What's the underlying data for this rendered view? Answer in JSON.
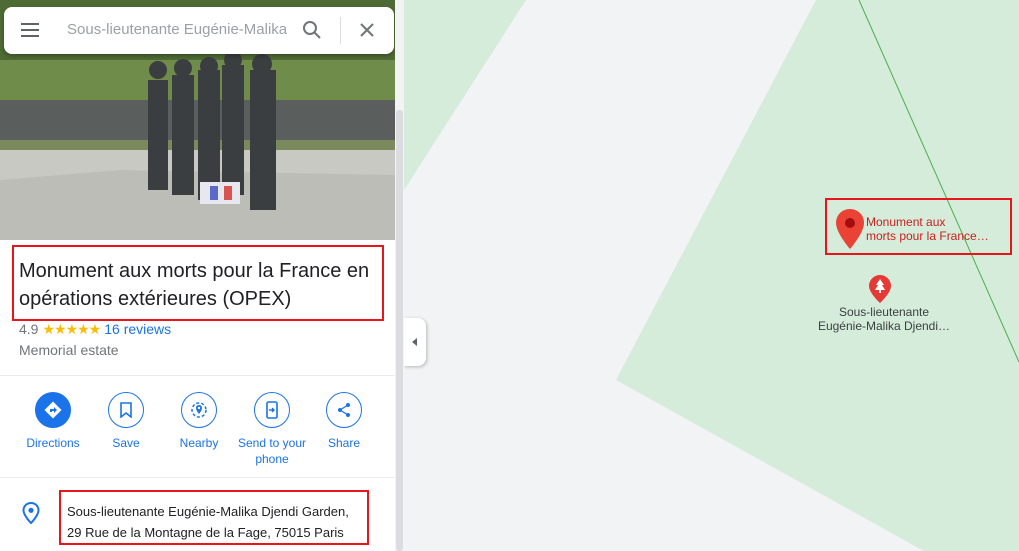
{
  "search": {
    "value": "Sous-lieutenante Eugénie-Malika Djendi Garden"
  },
  "place": {
    "title": "Monument aux morts pour la France en opérations extérieures (OPEX)",
    "rating": "4.9",
    "stars": "★★★★★",
    "reviews": "16 reviews",
    "category": "Memorial estate",
    "address_line1": "Sous-lieutenante Eugénie-Malika Djendi Garden,",
    "address_line2": "29 Rue de la Montagne de la Fage, 75015 Paris"
  },
  "actions": [
    {
      "label": "Directions",
      "icon": "directions-icon"
    },
    {
      "label": "Save",
      "icon": "bookmark-icon"
    },
    {
      "label": "Nearby",
      "icon": "nearby-icon"
    },
    {
      "label": "Send to your phone",
      "icon": "send-to-phone-icon"
    },
    {
      "label": "Share",
      "icon": "share-icon"
    }
  ],
  "map": {
    "pin_label_line1": "Monument aux",
    "pin_label_line2": "morts pour la France…",
    "park_label_line1": "Sous-lieutenante",
    "park_label_line2": "Eugénie-Malika Djendi…"
  },
  "colors": {
    "accent": "#1a73e8",
    "pin": "#ea4335",
    "park": "#cfe9d4",
    "highlight": "#e8161b"
  }
}
